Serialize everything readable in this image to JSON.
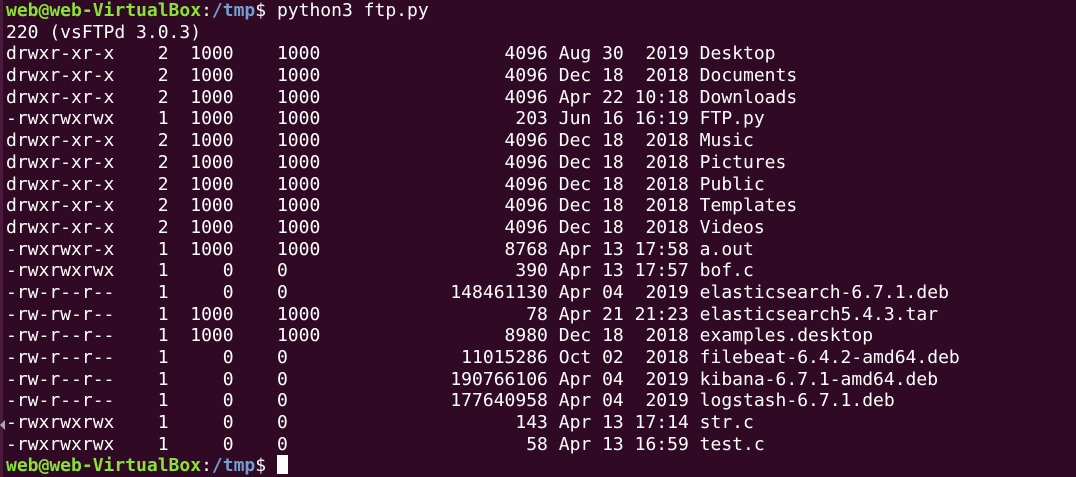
{
  "prompt": {
    "user_host": "web@web-VirtualBox",
    "separator": ":",
    "path": "/tmp",
    "dollar": "$"
  },
  "command": " python3 ftp.py",
  "server_greeting": "220 (vsFTPd 3.0.3)",
  "listing": [
    {
      "perms": "drwxr-xr-x",
      "links": "2",
      "owner": "1000",
      "group": "1000",
      "size": "4096",
      "month": "Aug",
      "day": "30",
      "time": "2019",
      "name": "Desktop"
    },
    {
      "perms": "drwxr-xr-x",
      "links": "2",
      "owner": "1000",
      "group": "1000",
      "size": "4096",
      "month": "Dec",
      "day": "18",
      "time": "2018",
      "name": "Documents"
    },
    {
      "perms": "drwxr-xr-x",
      "links": "2",
      "owner": "1000",
      "group": "1000",
      "size": "4096",
      "month": "Apr",
      "day": "22",
      "time": "10:18",
      "name": "Downloads"
    },
    {
      "perms": "-rwxrwxrwx",
      "links": "1",
      "owner": "1000",
      "group": "1000",
      "size": "203",
      "month": "Jun",
      "day": "16",
      "time": "16:19",
      "name": "FTP.py"
    },
    {
      "perms": "drwxr-xr-x",
      "links": "2",
      "owner": "1000",
      "group": "1000",
      "size": "4096",
      "month": "Dec",
      "day": "18",
      "time": "2018",
      "name": "Music"
    },
    {
      "perms": "drwxr-xr-x",
      "links": "2",
      "owner": "1000",
      "group": "1000",
      "size": "4096",
      "month": "Dec",
      "day": "18",
      "time": "2018",
      "name": "Pictures"
    },
    {
      "perms": "drwxr-xr-x",
      "links": "2",
      "owner": "1000",
      "group": "1000",
      "size": "4096",
      "month": "Dec",
      "day": "18",
      "time": "2018",
      "name": "Public"
    },
    {
      "perms": "drwxr-xr-x",
      "links": "2",
      "owner": "1000",
      "group": "1000",
      "size": "4096",
      "month": "Dec",
      "day": "18",
      "time": "2018",
      "name": "Templates"
    },
    {
      "perms": "drwxr-xr-x",
      "links": "2",
      "owner": "1000",
      "group": "1000",
      "size": "4096",
      "month": "Dec",
      "day": "18",
      "time": "2018",
      "name": "Videos"
    },
    {
      "perms": "-rwxrwxr-x",
      "links": "1",
      "owner": "1000",
      "group": "1000",
      "size": "8768",
      "month": "Apr",
      "day": "13",
      "time": "17:58",
      "name": "a.out"
    },
    {
      "perms": "-rwxrwxrwx",
      "links": "1",
      "owner": "0",
      "group": "0",
      "size": "390",
      "month": "Apr",
      "day": "13",
      "time": "17:57",
      "name": "bof.c"
    },
    {
      "perms": "-rw-r--r--",
      "links": "1",
      "owner": "0",
      "group": "0",
      "size": "148461130",
      "month": "Apr",
      "day": "04",
      "time": "2019",
      "name": "elasticsearch-6.7.1.deb"
    },
    {
      "perms": "-rw-rw-r--",
      "links": "1",
      "owner": "1000",
      "group": "1000",
      "size": "78",
      "month": "Apr",
      "day": "21",
      "time": "21:23",
      "name": "elasticsearch5.4.3.tar"
    },
    {
      "perms": "-rw-r--r--",
      "links": "1",
      "owner": "1000",
      "group": "1000",
      "size": "8980",
      "month": "Dec",
      "day": "18",
      "time": "2018",
      "name": "examples.desktop"
    },
    {
      "perms": "-rw-r--r--",
      "links": "1",
      "owner": "0",
      "group": "0",
      "size": "11015286",
      "month": "Oct",
      "day": "02",
      "time": "2018",
      "name": "filebeat-6.4.2-amd64.deb"
    },
    {
      "perms": "-rw-r--r--",
      "links": "1",
      "owner": "0",
      "group": "0",
      "size": "190766106",
      "month": "Apr",
      "day": "04",
      "time": "2019",
      "name": "kibana-6.7.1-amd64.deb"
    },
    {
      "perms": "-rw-r--r--",
      "links": "1",
      "owner": "0",
      "group": "0",
      "size": "177640958",
      "month": "Apr",
      "day": "04",
      "time": "2019",
      "name": "logstash-6.7.1.deb"
    },
    {
      "perms": "-rwxrwxrwx",
      "links": "1",
      "owner": "0",
      "group": "0",
      "size": "143",
      "month": "Apr",
      "day": "13",
      "time": "17:14",
      "name": "str.c"
    },
    {
      "perms": "-rwxrwxrwx",
      "links": "1",
      "owner": "0",
      "group": "0",
      "size": "58",
      "month": "Apr",
      "day": "13",
      "time": "16:59",
      "name": "test.c"
    }
  ],
  "colors": {
    "background": "#300a24",
    "prompt_user": "#8ae234",
    "prompt_path": "#729fcf",
    "text": "#ffffff"
  }
}
